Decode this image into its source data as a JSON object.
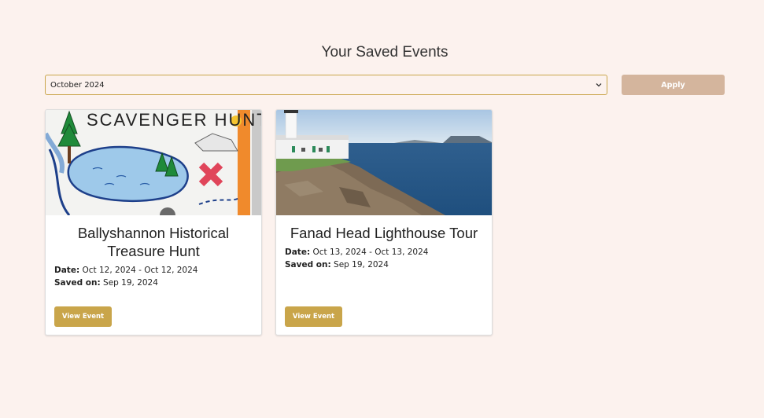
{
  "page": {
    "title": "Your Saved Events"
  },
  "filter": {
    "selected_month": "October 2024",
    "apply_label": "Apply"
  },
  "events": [
    {
      "title": "Ballyshannon Historical Treasure Hunt",
      "date_label": "Date:",
      "date_value": "Oct 12, 2024 - Oct 12, 2024",
      "saved_label": "Saved on:",
      "saved_value": "Sep 19, 2024",
      "button_label": "View Event",
      "image_text": "SCAVENGER HUNT"
    },
    {
      "title": "Fanad Head Lighthouse Tour",
      "date_label": "Date:",
      "date_value": "Oct 13, 2024 - Oct 13, 2024",
      "saved_label": "Saved on:",
      "saved_value": "Sep 19, 2024",
      "button_label": "View Event"
    }
  ],
  "colors": {
    "background": "#fcf2ee",
    "accent": "#c9a54a",
    "apply_button": "#d4b59d"
  },
  "icons": {
    "select": "chevron-down-icon"
  }
}
